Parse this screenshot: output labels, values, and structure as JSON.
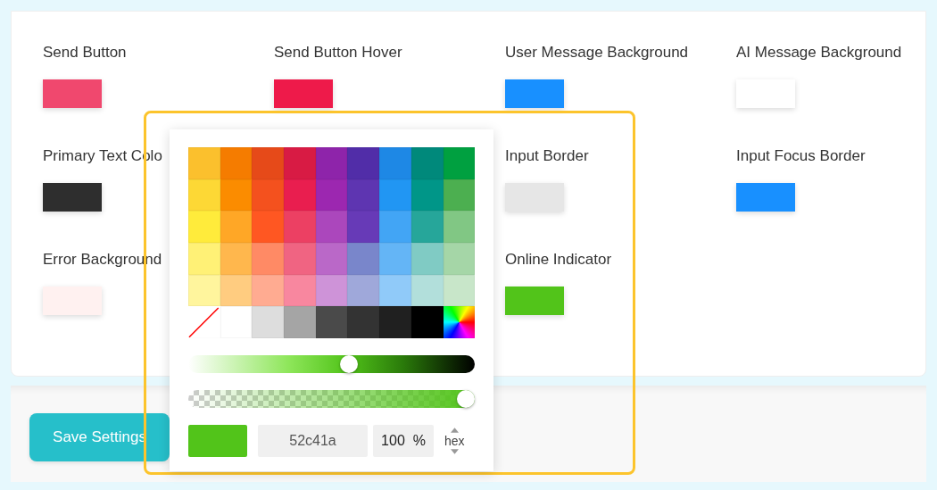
{
  "color_settings": [
    {
      "kind": "color",
      "label": "Send Button",
      "color": "#f0486e"
    },
    {
      "kind": "color",
      "label": "Send Button Hover",
      "color": "#ee1a4a"
    },
    {
      "kind": "color",
      "label": "User Message Background",
      "color": "#1890ff"
    },
    {
      "kind": "color",
      "label": "AI Message Background",
      "color": "#ffffff"
    },
    {
      "kind": "color",
      "label": "Primary Text Colo",
      "color": "#2e2e2e"
    },
    {
      "kind": "covered"
    },
    {
      "kind": "color",
      "label": "Input Border",
      "color": "#e6e6e6"
    },
    {
      "kind": "color",
      "label": "Input Focus Border",
      "color": "#1890ff"
    },
    {
      "kind": "color",
      "label": "Error Background",
      "color": "#fff1f0"
    },
    {
      "kind": "covered"
    },
    {
      "kind": "color",
      "label": "Online Indicator",
      "color": "#52c41a"
    }
  ],
  "color_picker": {
    "palette": [
      {
        "kind": "color",
        "color": "#fbc02d"
      },
      {
        "kind": "color",
        "color": "#f57c00"
      },
      {
        "kind": "color",
        "color": "#e64a19"
      },
      {
        "kind": "color",
        "color": "#d81b44"
      },
      {
        "kind": "color",
        "color": "#8e24aa"
      },
      {
        "kind": "color",
        "color": "#512da8"
      },
      {
        "kind": "color",
        "color": "#1e88e5"
      },
      {
        "kind": "color",
        "color": "#00897b"
      },
      {
        "kind": "color",
        "color": "#00a040"
      },
      {
        "kind": "color",
        "color": "#fdd835"
      },
      {
        "kind": "color",
        "color": "#fb8c00"
      },
      {
        "kind": "color",
        "color": "#f4511e"
      },
      {
        "kind": "color",
        "color": "#e91e4f"
      },
      {
        "kind": "color",
        "color": "#9c27b0"
      },
      {
        "kind": "color",
        "color": "#5e35b1"
      },
      {
        "kind": "color",
        "color": "#2196f3"
      },
      {
        "kind": "color",
        "color": "#009688"
      },
      {
        "kind": "color",
        "color": "#4caf50"
      },
      {
        "kind": "color",
        "color": "#ffeb3b"
      },
      {
        "kind": "color",
        "color": "#ffa726"
      },
      {
        "kind": "color",
        "color": "#ff5722"
      },
      {
        "kind": "color",
        "color": "#ec4063"
      },
      {
        "kind": "color",
        "color": "#ab47bc"
      },
      {
        "kind": "color",
        "color": "#673ab7"
      },
      {
        "kind": "color",
        "color": "#42a5f5"
      },
      {
        "kind": "color",
        "color": "#26a69a"
      },
      {
        "kind": "color",
        "color": "#81c784"
      },
      {
        "kind": "color",
        "color": "#fff176"
      },
      {
        "kind": "color",
        "color": "#ffb74d"
      },
      {
        "kind": "color",
        "color": "#ff8a65"
      },
      {
        "kind": "color",
        "color": "#f06482"
      },
      {
        "kind": "color",
        "color": "#ba68c8"
      },
      {
        "kind": "color",
        "color": "#7986cb"
      },
      {
        "kind": "color",
        "color": "#64b5f6"
      },
      {
        "kind": "color",
        "color": "#80cbc4"
      },
      {
        "kind": "color",
        "color": "#a5d6a7"
      },
      {
        "kind": "color",
        "color": "#fff59d"
      },
      {
        "kind": "color",
        "color": "#ffcc80"
      },
      {
        "kind": "color",
        "color": "#ffab91"
      },
      {
        "kind": "color",
        "color": "#f8879f"
      },
      {
        "kind": "color",
        "color": "#ce93d8"
      },
      {
        "kind": "color",
        "color": "#9fa8da"
      },
      {
        "kind": "color",
        "color": "#90caf9"
      },
      {
        "kind": "color",
        "color": "#b2dfdb"
      },
      {
        "kind": "color",
        "color": "#c8e6c9"
      },
      {
        "kind": "none"
      },
      {
        "kind": "color",
        "color": "#ffffff"
      },
      {
        "kind": "color",
        "color": "#dddddd"
      },
      {
        "kind": "color",
        "color": "#a5a5a5"
      },
      {
        "kind": "color",
        "color": "#4a4a4a"
      },
      {
        "kind": "color",
        "color": "#333333"
      },
      {
        "kind": "color",
        "color": "#202020"
      },
      {
        "kind": "color",
        "color": "#000000"
      },
      {
        "kind": "spectrum"
      }
    ],
    "shade": {
      "level": 0.56
    },
    "alpha": {
      "level": 1
    },
    "hex_value": "52c41a",
    "alpha_value": "100",
    "alpha_unit": "%",
    "format": "hex"
  },
  "save_button": "Save Settings"
}
